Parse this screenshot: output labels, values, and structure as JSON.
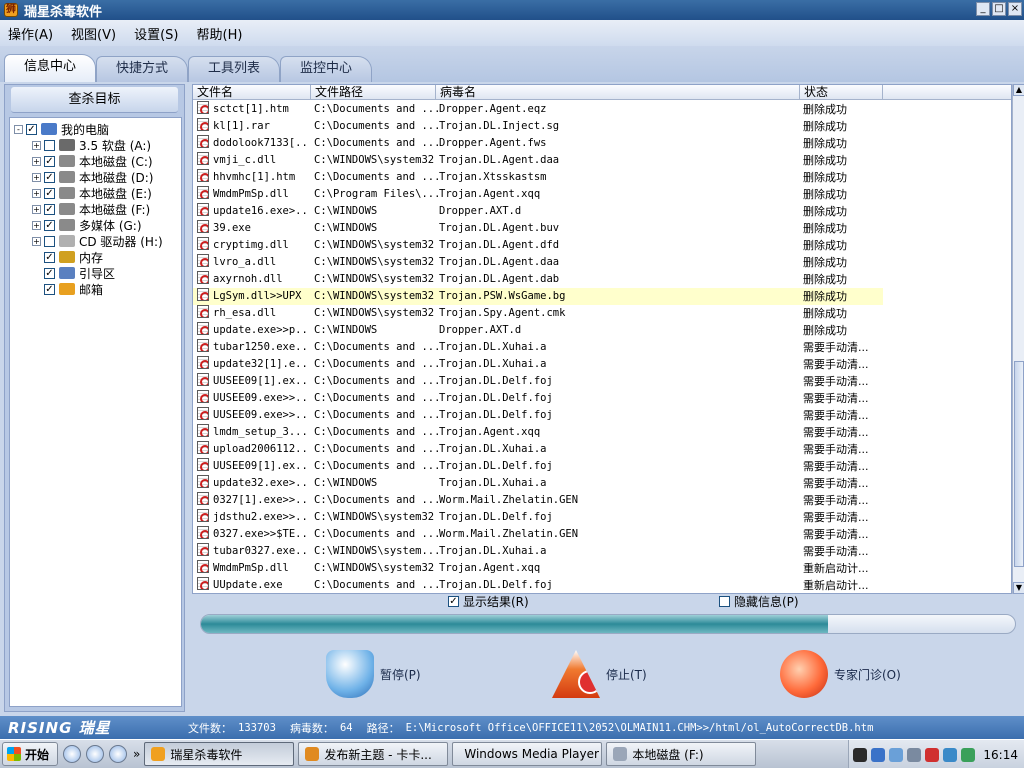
{
  "window": {
    "title": "瑞星杀毒软件",
    "app_icon": "rising-lion-icon"
  },
  "menu": [
    {
      "label": "操作(A)"
    },
    {
      "label": "视图(V)"
    },
    {
      "label": "设置(S)"
    },
    {
      "label": "帮助(H)"
    }
  ],
  "tabs": [
    {
      "label": "信息中心",
      "active": true
    },
    {
      "label": "快捷方式",
      "active": false
    },
    {
      "label": "工具列表",
      "active": false
    },
    {
      "label": "监控中心",
      "active": false
    }
  ],
  "left_panel": {
    "title": "查杀目标",
    "tree": [
      {
        "label": "我的电脑",
        "checked": true,
        "expander": "-",
        "icon": "computer-icon"
      },
      {
        "label": "3.5 软盘 (A:)",
        "checked": false,
        "expander": "+",
        "icon": "floppy-icon"
      },
      {
        "label": "本地磁盘 (C:)",
        "checked": true,
        "expander": "+",
        "icon": "disk-icon"
      },
      {
        "label": "本地磁盘 (D:)",
        "checked": true,
        "expander": "+",
        "icon": "disk-icon"
      },
      {
        "label": "本地磁盘 (E:)",
        "checked": true,
        "expander": "+",
        "icon": "disk-icon"
      },
      {
        "label": "本地磁盘 (F:)",
        "checked": true,
        "expander": "+",
        "icon": "disk-icon"
      },
      {
        "label": "多媒体 (G:)",
        "checked": true,
        "expander": "+",
        "icon": "disk-icon"
      },
      {
        "label": "CD 驱动器 (H:)",
        "checked": false,
        "expander": "+",
        "icon": "cdrom-icon"
      },
      {
        "label": "内存",
        "checked": true,
        "expander": "",
        "icon": "memory-icon"
      },
      {
        "label": "引导区",
        "checked": true,
        "expander": "",
        "icon": "boot-sector-icon"
      },
      {
        "label": "邮箱",
        "checked": true,
        "expander": "",
        "icon": "mail-icon"
      }
    ]
  },
  "table": {
    "columns": [
      "文件名",
      "文件路径",
      "病毒名",
      "状态"
    ],
    "rows": [
      [
        "sctct[1].htm",
        "C:\\Documents and ...",
        "Dropper.Agent.eqz",
        "删除成功"
      ],
      [
        "kl[1].rar",
        "C:\\Documents and ...",
        "Trojan.DL.Inject.sg",
        "删除成功"
      ],
      [
        "dodolook7133[...",
        "C:\\Documents and ...",
        "Dropper.Agent.fws",
        "删除成功"
      ],
      [
        "vmji_c.dll",
        "C:\\WINDOWS\\system32",
        "Trojan.DL.Agent.daa",
        "删除成功"
      ],
      [
        "hhvmhc[1].htm",
        "C:\\Documents and ...",
        "Trojan.Xtsskastsm",
        "删除成功"
      ],
      [
        "WmdmPmSp.dll",
        "C:\\Program Files\\...",
        "Trojan.Agent.xqq",
        "删除成功"
      ],
      [
        "update16.exe>...",
        "C:\\WINDOWS",
        "Dropper.AXT.d",
        "删除成功"
      ],
      [
        "39.exe",
        "C:\\WINDOWS",
        "Trojan.DL.Agent.buv",
        "删除成功"
      ],
      [
        "cryptimg.dll",
        "C:\\WINDOWS\\system32",
        "Trojan.DL.Agent.dfd",
        "删除成功"
      ],
      [
        "lvro_a.dll",
        "C:\\WINDOWS\\system32",
        "Trojan.DL.Agent.daa",
        "删除成功"
      ],
      [
        "axyrnoh.dll",
        "C:\\WINDOWS\\system32",
        "Trojan.DL.Agent.dab",
        "删除成功"
      ],
      [
        "LgSym.dll>>UPX",
        "C:\\WINDOWS\\system32",
        "Trojan.PSW.WsGame.bg",
        "删除成功"
      ],
      [
        "rh_esa.dll",
        "C:\\WINDOWS\\system32",
        "Trojan.Spy.Agent.cmk",
        "删除成功"
      ],
      [
        "update.exe>>p...",
        "C:\\WINDOWS",
        "Dropper.AXT.d",
        "删除成功"
      ],
      [
        "tubar1250.exe...",
        "C:\\Documents and ...",
        "Trojan.DL.Xuhai.a",
        "需要手动清..."
      ],
      [
        "update32[1].e...",
        "C:\\Documents and ...",
        "Trojan.DL.Xuhai.a",
        "需要手动清..."
      ],
      [
        "UUSEE09[1].ex...",
        "C:\\Documents and ...",
        "Trojan.DL.Delf.foj",
        "需要手动清..."
      ],
      [
        "UUSEE09.exe>>...",
        "C:\\Documents and ...",
        "Trojan.DL.Delf.foj",
        "需要手动清..."
      ],
      [
        "UUSEE09.exe>>...",
        "C:\\Documents and ...",
        "Trojan.DL.Delf.foj",
        "需要手动清..."
      ],
      [
        "lmdm_setup_3...",
        "C:\\Documents and ...",
        "Trojan.Agent.xqq",
        "需要手动清..."
      ],
      [
        "upload2006112...",
        "C:\\Documents and ...",
        "Trojan.DL.Xuhai.a",
        "需要手动清..."
      ],
      [
        "UUSEE09[1].ex...",
        "C:\\Documents and ...",
        "Trojan.DL.Delf.foj",
        "需要手动清..."
      ],
      [
        "update32.exe>...",
        "C:\\WINDOWS",
        "Trojan.DL.Xuhai.a",
        "需要手动清..."
      ],
      [
        "0327[1].exe>>...",
        "C:\\Documents and ...",
        "Worm.Mail.Zhelatin.GEN",
        "需要手动清..."
      ],
      [
        "jdsthu2.exe>>...",
        "C:\\WINDOWS\\system32",
        "Trojan.DL.Delf.foj",
        "需要手动清..."
      ],
      [
        "0327.exe>>$TE...",
        "C:\\Documents and ...",
        "Worm.Mail.Zhelatin.GEN",
        "需要手动清..."
      ],
      [
        "tubar0327.exe...",
        "C:\\WINDOWS\\system...",
        "Trojan.DL.Xuhai.a",
        "需要手动清..."
      ],
      [
        "WmdmPmSp.dll",
        "C:\\WINDOWS\\system32",
        "Trojan.Agent.xqq",
        "重新启动计..."
      ],
      [
        "UUpdate.exe",
        "C:\\Documents and ...",
        "Trojan.DL.Delf.foj",
        "重新启动计..."
      ]
    ],
    "highlighted_row": 11
  },
  "options": {
    "show_results": {
      "label": "显示结果(R)",
      "checked": true
    },
    "hide_info": {
      "label": "隐藏信息(P)",
      "checked": false
    }
  },
  "progress": {
    "fraction": 0.77
  },
  "actions": {
    "pause": "暂停(P)",
    "stop": "停止(T)",
    "expert": "专家门诊(O)"
  },
  "status": {
    "logo": "RISING 瑞星",
    "files_label": "文件数：",
    "files_value": "133703",
    "virus_label": "病毒数：",
    "virus_value": "64",
    "path_label": "路径：",
    "path_value": "E:\\Microsoft Office\\OFFICE11\\2052\\OLMAIN11.CHM>>/html/ol_AutoCorrectDB.htm"
  },
  "taskbar": {
    "start": "开始",
    "tasks": [
      {
        "label": "瑞星杀毒软件",
        "active": true,
        "icon": "rising-lion-icon"
      },
      {
        "label": "发布新主题 - 卡卡...",
        "active": false,
        "icon": "browser-icon"
      },
      {
        "label": "Windows Media Player",
        "active": false,
        "icon": "media-player-icon"
      },
      {
        "label": "本地磁盘 (F:)",
        "active": false,
        "icon": "disk-icon"
      }
    ],
    "clock": "16:14"
  },
  "colors": {
    "accent": "#3b6eae",
    "highlight_row": "#ffffcc",
    "progress": "#2d8a98"
  }
}
